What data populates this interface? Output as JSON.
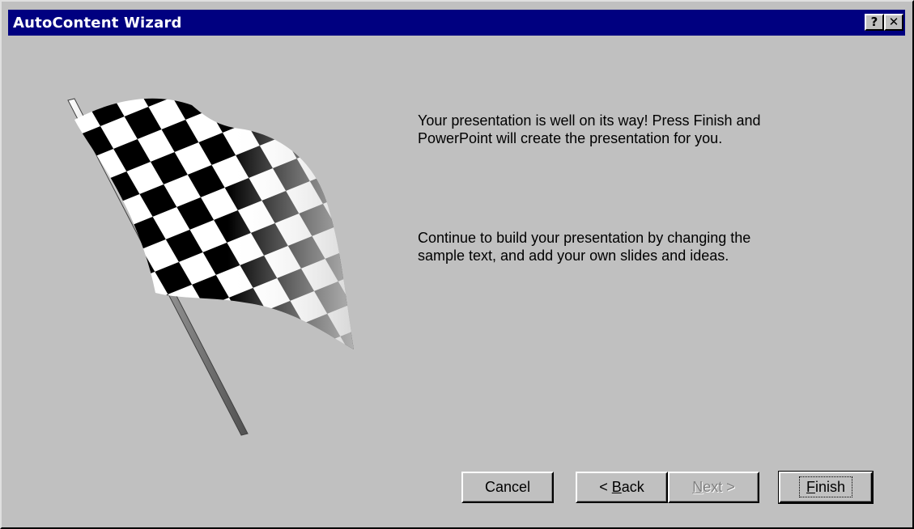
{
  "window": {
    "title": "AutoContent Wizard"
  },
  "titlebar": {
    "help_glyph": "?",
    "close_glyph": "✕"
  },
  "content": {
    "message_1": "Your presentation is well on its way!  Press Finish and\nPowerPoint will create the presentation for you.",
    "message_2": "Continue to build your presentation by changing the\nsample text, and add your own slides and ideas."
  },
  "buttons": {
    "cancel": "Cancel",
    "back_prefix": "< ",
    "back_mnemonic": "B",
    "back_rest": "ack",
    "next_mnemonic": "N",
    "next_rest": "ext >",
    "finish_mnemonic": "F",
    "finish_rest": "inish"
  },
  "icons": {
    "flag": "checkered-flag-icon"
  },
  "colors": {
    "titlebar": "#000080",
    "face": "#c0c0c0"
  }
}
